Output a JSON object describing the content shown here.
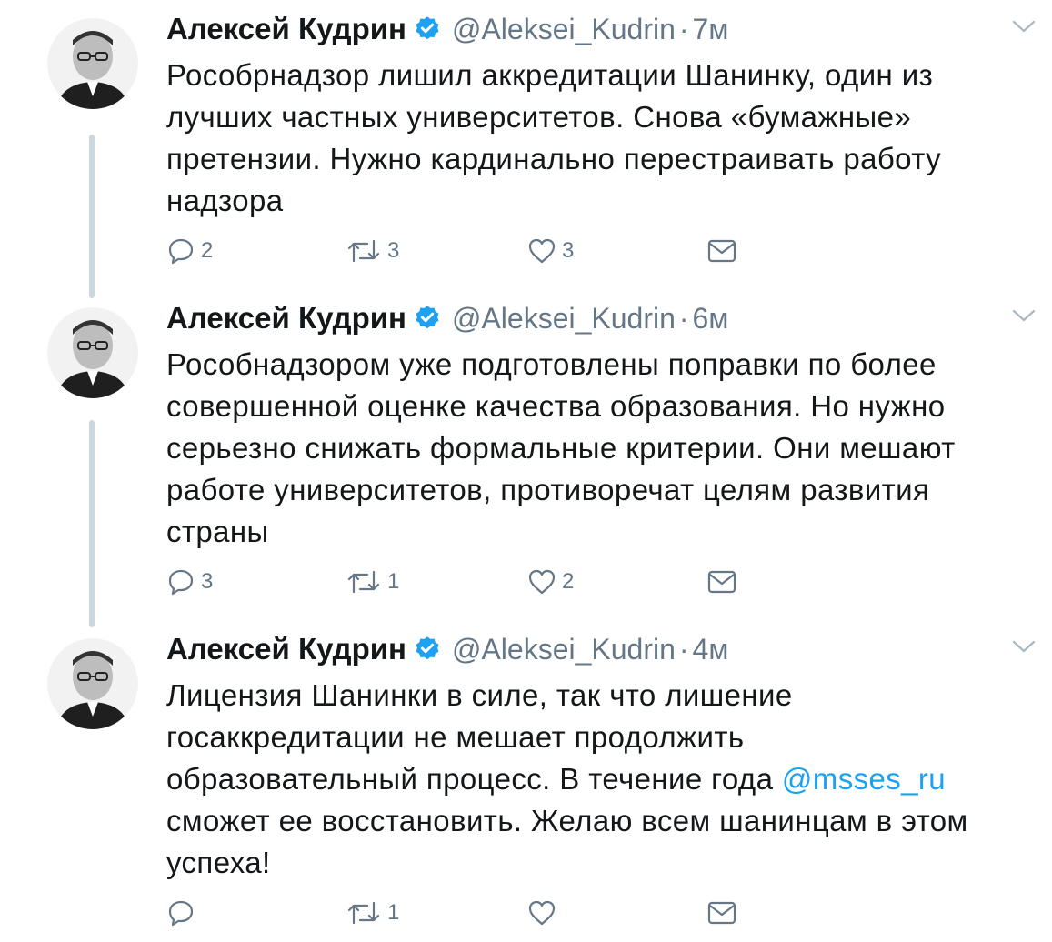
{
  "tweets": [
    {
      "name": "Алексей Кудрин",
      "handle": "@Aleksei_Kudrin",
      "separator": "·",
      "time": "7м",
      "lines": [
        "Рособрнадзор лишил аккредитации Шанинку, один из",
        "лучших частных университетов. Снова «бумажные»",
        "претензии. Нужно кардинально перестраивать работу",
        "надзора"
      ],
      "replies": "2",
      "retweets": "3",
      "likes": "3"
    },
    {
      "name": "Алексей Кудрин",
      "handle": "@Aleksei_Kudrin",
      "separator": "·",
      "time": "6м",
      "lines": [
        "Рособнадзором уже подготовлены поправки по более",
        "совершенной оценке качества образования. Но нужно",
        "серьезно снижать формальные критерии. Они мешают",
        "работе университетов, противоречат целям развития",
        "страны"
      ],
      "replies": "3",
      "retweets": "1",
      "likes": "2"
    },
    {
      "name": "Алексей Кудрин",
      "handle": "@Aleksei_Kudrin",
      "separator": "·",
      "time": "4м",
      "lines": [
        "Лицензия Шанинки в силе, так что лишение",
        "госаккредитации не мешает продолжить",
        "образовательный процесс. В течение года ",
        "сможет ее восстановить. Желаю всем шанинцам в этом",
        "успеха!"
      ],
      "mention": "@msses_ru",
      "replies": "",
      "retweets": "1",
      "likes": ""
    }
  ],
  "colors": {
    "text": "#14171a",
    "secondary": "#657786",
    "link": "#1da1f2",
    "verified": "#1da1f2",
    "thread_line": "#ccd6dd"
  },
  "icons": [
    "verified-badge-icon",
    "chevron-down-icon",
    "reply-icon",
    "retweet-icon",
    "like-icon",
    "direct-message-icon"
  ]
}
